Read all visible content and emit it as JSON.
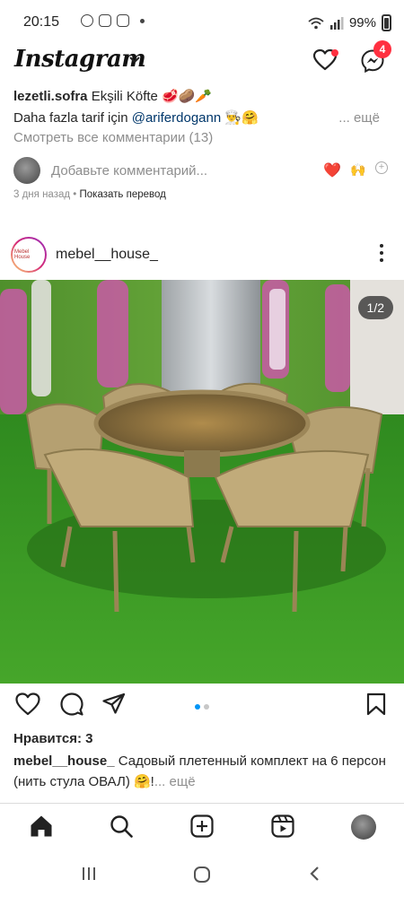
{
  "status_bar": {
    "time": "20:15",
    "battery": "99%"
  },
  "app": {
    "logo": "Instagram",
    "messages_badge": "4"
  },
  "previous_post": {
    "username": "lezetli.sofra",
    "text_line1": "Ekşili Köfte 🥩🥔🥕",
    "text_line2_prefix": "Daha fazla tarif için",
    "mention": "@ariferdogann",
    "text_line2_emoji": "👨‍🍳🤗",
    "more": "... ещё",
    "view_all_comments": "Смотреть все комментарии (13)",
    "add_comment_placeholder": "Добавьте комментарий...",
    "quick_emoji_1": "❤️",
    "quick_emoji_2": "🙌",
    "time_ago": "3 дня назад",
    "separator": "•",
    "translate": "Показать перевод"
  },
  "post": {
    "username": "mebel__house_",
    "avatar_text": "Mebel House",
    "photo_counter": "1/2",
    "likes": "Нравится: 3",
    "caption_username": "mebel__house_",
    "caption_text": "Садовый плетенный комплект на 6 персон (нить стула ОВАЛ) 🤗!",
    "caption_more": "... ещё"
  },
  "colors": {
    "accent_blue": "#0095f6",
    "notification_red": "#ff3040",
    "mention_blue": "#00376b",
    "muted_text": "#8e8e8e"
  },
  "icons": {
    "heart": "heart-icon",
    "messenger": "messenger-icon",
    "comment": "comment-icon",
    "share": "share-icon",
    "bookmark": "bookmark-icon",
    "home": "home-icon",
    "search": "search-icon",
    "create": "create-icon",
    "reels": "reels-icon"
  }
}
